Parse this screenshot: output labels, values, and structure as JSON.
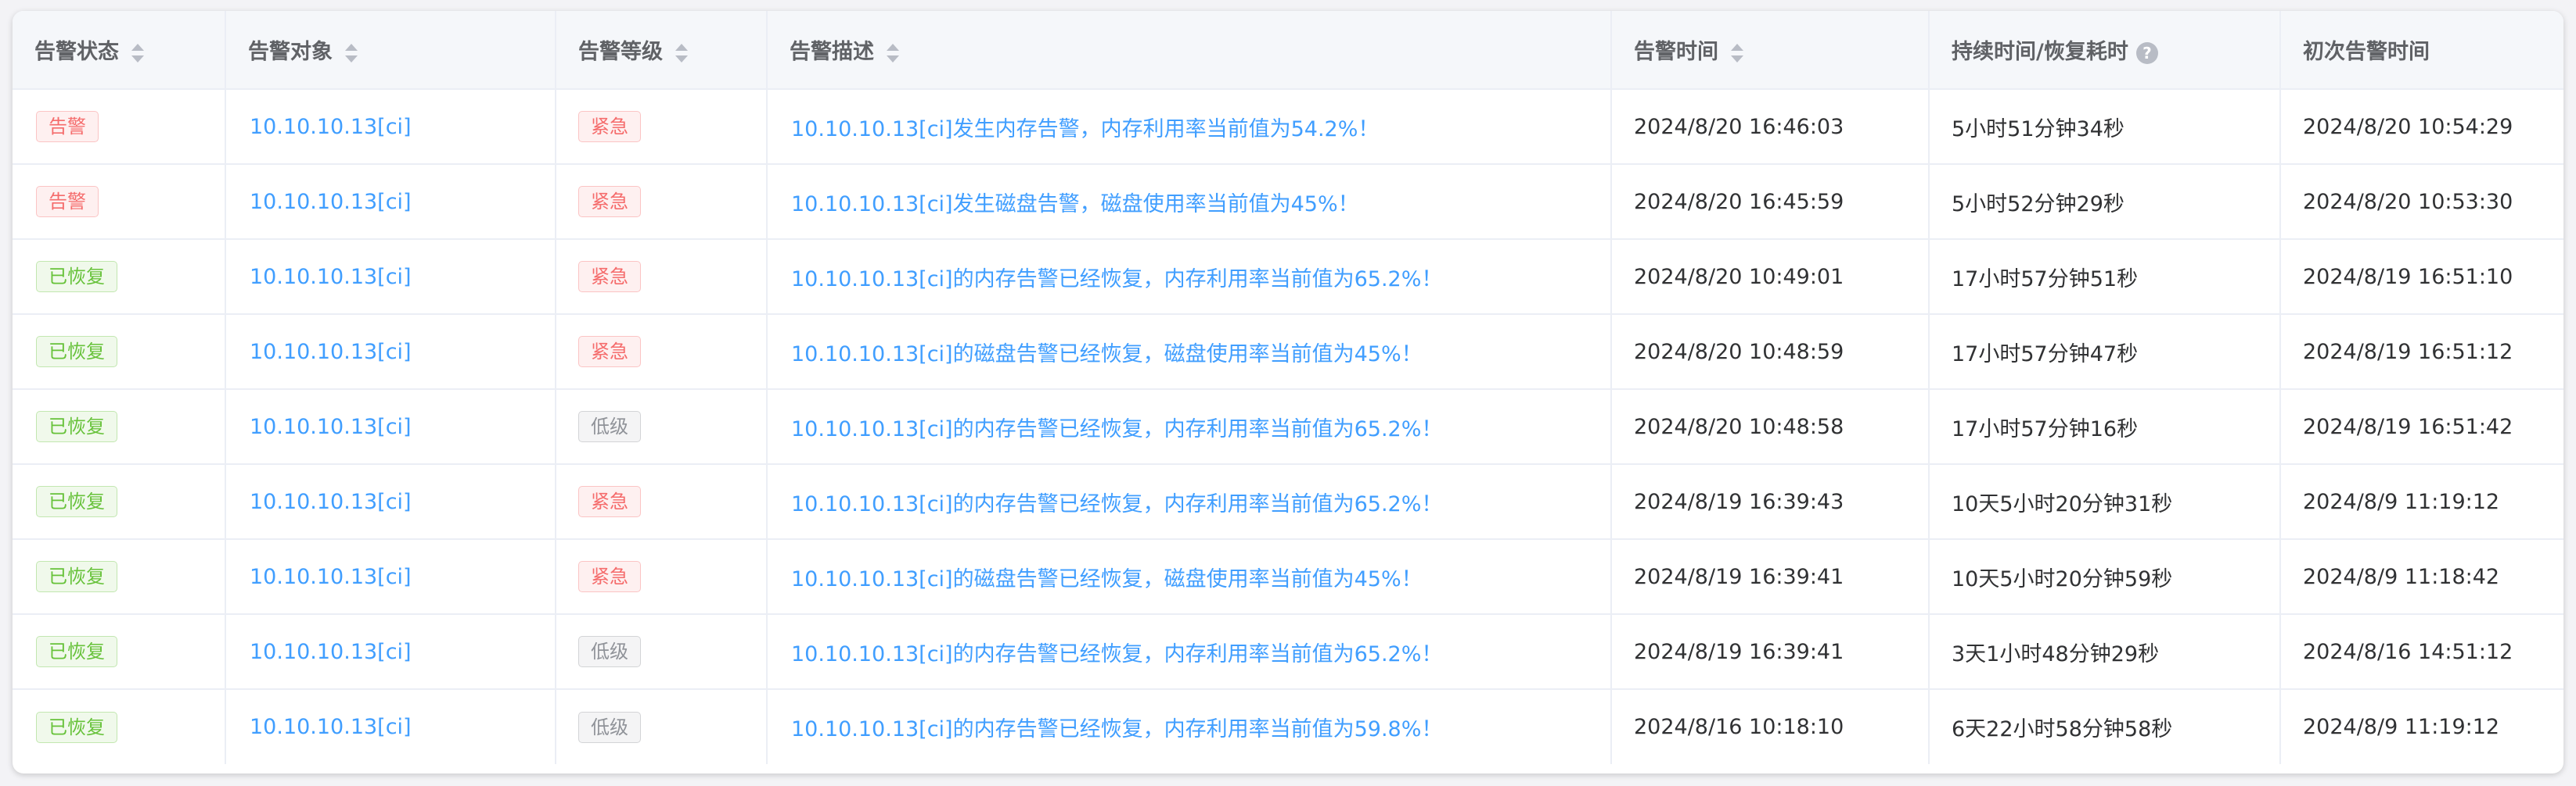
{
  "columns": [
    {
      "label": "告警状态",
      "sortable": true
    },
    {
      "label": "告警对象",
      "sortable": true
    },
    {
      "label": "告警等级",
      "sortable": true
    },
    {
      "label": "告警描述",
      "sortable": true
    },
    {
      "label": "告警时间",
      "sortable": true
    },
    {
      "label": "持续时间/恢复耗时",
      "help": "?"
    },
    {
      "label": "初次告警时间"
    }
  ],
  "rows": [
    {
      "status": "告警",
      "status_type": "alarm",
      "target": "10.10.10.13[ci]",
      "level": "紧急",
      "level_type": "urgent",
      "desc": "10.10.10.13[ci]发生内存告警，内存利用率当前值为54.2%！",
      "time": "2024/8/20 16:46:03",
      "duration": "5小时51分钟34秒",
      "first_time": "2024/8/20 10:54:29"
    },
    {
      "status": "告警",
      "status_type": "alarm",
      "target": "10.10.10.13[ci]",
      "level": "紧急",
      "level_type": "urgent",
      "desc": "10.10.10.13[ci]发生磁盘告警，磁盘使用率当前值为45%！",
      "time": "2024/8/20 16:45:59",
      "duration": "5小时52分钟29秒",
      "first_time": "2024/8/20 10:53:30"
    },
    {
      "status": "已恢复",
      "status_type": "ok",
      "target": "10.10.10.13[ci]",
      "level": "紧急",
      "level_type": "urgent",
      "desc": "10.10.10.13[ci]的内存告警已经恢复，内存利用率当前值为65.2%！",
      "time": "2024/8/20 10:49:01",
      "duration": "17小时57分钟51秒",
      "first_time": "2024/8/19 16:51:10"
    },
    {
      "status": "已恢复",
      "status_type": "ok",
      "target": "10.10.10.13[ci]",
      "level": "紧急",
      "level_type": "urgent",
      "desc": "10.10.10.13[ci]的磁盘告警已经恢复，磁盘使用率当前值为45%！",
      "time": "2024/8/20 10:48:59",
      "duration": "17小时57分钟47秒",
      "first_time": "2024/8/19 16:51:12"
    },
    {
      "status": "已恢复",
      "status_type": "ok",
      "target": "10.10.10.13[ci]",
      "level": "低级",
      "level_type": "low",
      "desc": "10.10.10.13[ci]的内存告警已经恢复，内存利用率当前值为65.2%！",
      "time": "2024/8/20 10:48:58",
      "duration": "17小时57分钟16秒",
      "first_time": "2024/8/19 16:51:42"
    },
    {
      "status": "已恢复",
      "status_type": "ok",
      "target": "10.10.10.13[ci]",
      "level": "紧急",
      "level_type": "urgent",
      "desc": "10.10.10.13[ci]的内存告警已经恢复，内存利用率当前值为65.2%！",
      "time": "2024/8/19 16:39:43",
      "duration": "10天5小时20分钟31秒",
      "first_time": "2024/8/9 11:19:12"
    },
    {
      "status": "已恢复",
      "status_type": "ok",
      "target": "10.10.10.13[ci]",
      "level": "紧急",
      "level_type": "urgent",
      "desc": "10.10.10.13[ci]的磁盘告警已经恢复，磁盘使用率当前值为45%！",
      "time": "2024/8/19 16:39:41",
      "duration": "10天5小时20分钟59秒",
      "first_time": "2024/8/9 11:18:42"
    },
    {
      "status": "已恢复",
      "status_type": "ok",
      "target": "10.10.10.13[ci]",
      "level": "低级",
      "level_type": "low",
      "desc": "10.10.10.13[ci]的内存告警已经恢复，内存利用率当前值为65.2%！",
      "time": "2024/8/19 16:39:41",
      "duration": "3天1小时48分钟29秒",
      "first_time": "2024/8/16 14:51:12"
    },
    {
      "status": "已恢复",
      "status_type": "ok",
      "target": "10.10.10.13[ci]",
      "level": "低级",
      "level_type": "low",
      "desc": "10.10.10.13[ci]的内存告警已经恢复，内存利用率当前值为59.8%！",
      "time": "2024/8/16 10:18:10",
      "duration": "6天22小时58分钟58秒",
      "first_time": "2024/8/9 11:19:12"
    }
  ],
  "colors": {
    "link": "#409eff",
    "alarm_red": "#f56c6c",
    "ok_green": "#67c23a",
    "low_grey": "#909399",
    "header_bg": "#f5f7fa"
  }
}
